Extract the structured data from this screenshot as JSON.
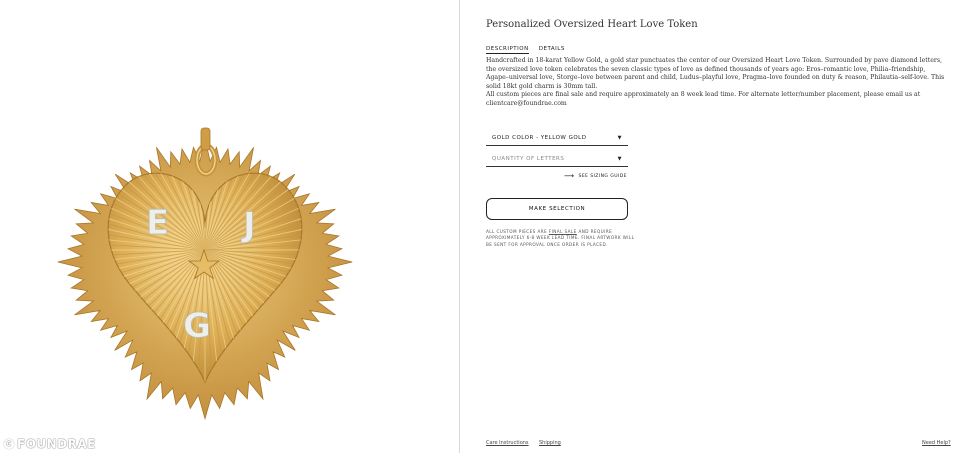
{
  "product": {
    "title": "Personalized Oversized Heart Love Token",
    "tabs": [
      {
        "label": "DESCRIPTION",
        "active": true
      },
      {
        "label": "DETAILS",
        "active": false
      }
    ],
    "description": [
      "Handcrafted in 18-karat Yellow Gold, a gold star punctuates the center of our Oversized Heart Love Token. Surrounded by pave diamond letters, the oversized love token celebrates the seven classic types of love as defined thousands of years ago: Eros–romantic love, Philia–friendship, Agape–universal love, Storge–love between parent and child, Ludus–playful love, Pragma–love founded on duty & reason, Philautia–self-love. This solid 18kt gold charm is 30mm tall.",
      "All custom pieces are final sale and require approximately an 8 week lead time. For alternate letter/number placement, please email us at clientcare@foundrae.com"
    ],
    "pendant_letters": [
      "E",
      "J",
      "G"
    ]
  },
  "options": {
    "gold_color": "GOLD COLOR - YELLOW GOLD",
    "quantity_placeholder": "QUANTITY OF LETTERS",
    "sizing_guide": "SEE SIZING GUIDE"
  },
  "actions": {
    "make_selection": "MAKE SELECTION"
  },
  "notice": {
    "pre": "ALL CUSTOM PIECES ARE ",
    "link": "FINAL SALE",
    "post": " AND REQUIRE APPROXIMATELY 6-8 WEEK LEAD TIME. FINAL ARTWORK WILL BE SENT FOR APPROVAL ONCE ORDER IS PLACED."
  },
  "footer": {
    "care": "Care Instructions",
    "shipping": "Shipping",
    "help": "Need Help?"
  },
  "watermark": {
    "symbol": "C",
    "text": "FOUNDRAE"
  },
  "colors": {
    "gold": "#d9a94d",
    "gold_dark": "#a8762a",
    "gold_light": "#f3d38a",
    "diamond": "#eeeeea"
  }
}
